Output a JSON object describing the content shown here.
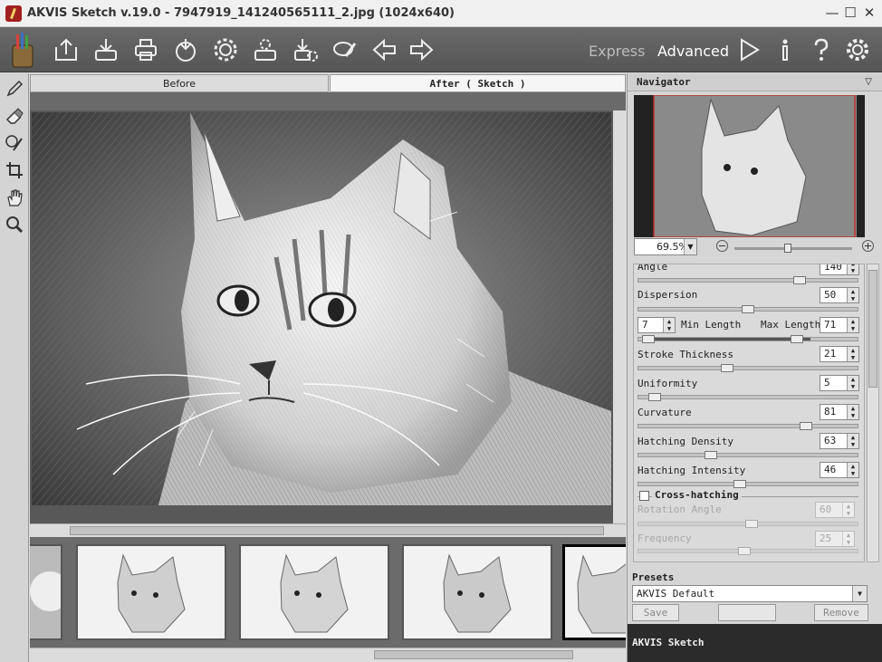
{
  "window": {
    "title": "AKVIS Sketch v.19.0 - 7947919_141240565111_2.jpg (1024x640)",
    "controls": [
      "—",
      "☐",
      "✕"
    ]
  },
  "toolbar": {
    "icons": [
      "sketch-logo",
      "open-icon",
      "save-icon",
      "print-icon",
      "share-icon",
      "plugin-settings-icon",
      "batch-icon",
      "batch-settings-icon",
      "cleaning-icon",
      "back-icon",
      "forward-icon"
    ],
    "mode_express": "Express",
    "mode_advanced": "Advanced",
    "right_icons": [
      "run-icon",
      "info-icon",
      "help-icon",
      "preferences-icon"
    ]
  },
  "left_tools": [
    "pencil-icon",
    "eraser-icon",
    "history-brush-icon",
    "crop-icon",
    "hand-icon",
    "zoom-icon"
  ],
  "tabs": {
    "before": "Before",
    "after": "After ( Sketch )"
  },
  "navigator": {
    "title": "Navigator",
    "zoom": "69.5%"
  },
  "params": {
    "angle": {
      "label": "Angle",
      "value": "140",
      "fraction": 0.75
    },
    "dispersion": {
      "label": "Dispersion",
      "value": "50",
      "fraction": 0.5
    },
    "min_length": {
      "label": "Min Length",
      "value": "7"
    },
    "max_length": {
      "label": "Max Length",
      "value": "71"
    },
    "stroke_thickness": {
      "label": "Stroke Thickness",
      "value": "21",
      "fraction": 0.4
    },
    "uniformity": {
      "label": "Uniformity",
      "value": "5",
      "fraction": 0.05
    },
    "curvature": {
      "label": "Curvature",
      "value": "81",
      "fraction": 0.78
    },
    "hatching_density": {
      "label": "Hatching Density",
      "value": "63",
      "fraction": 0.32
    },
    "hatching_intensity": {
      "label": "Hatching Intensity",
      "value": "46",
      "fraction": 0.46
    },
    "cross_hatching": {
      "label": "Cross-hatching"
    },
    "rotation_angle": {
      "label": "Rotation Angle",
      "value": "60"
    },
    "frequency": {
      "label": "Frequency",
      "value": "25"
    }
  },
  "presets": {
    "title": "Presets",
    "selected": "AKVIS Default",
    "save": "Save",
    "remove": "Remove"
  },
  "help": {
    "title": "AKVIS Sketch"
  }
}
